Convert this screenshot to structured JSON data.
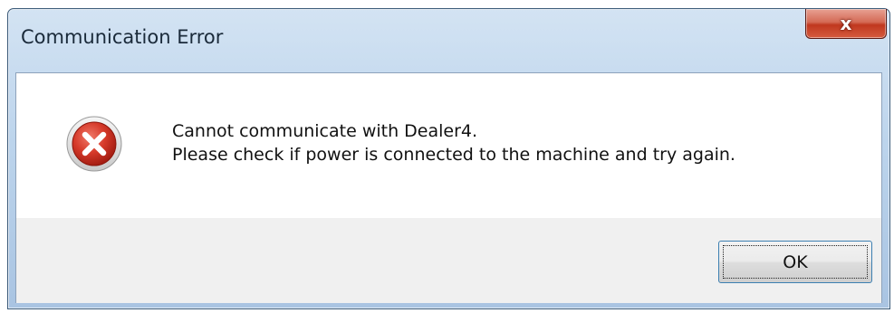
{
  "window": {
    "title": "Communication Error",
    "close_label": "x"
  },
  "message": {
    "line1": "Cannot communicate with Dealer4.",
    "line2": "Please check if power is connected to the machine and try again."
  },
  "buttons": {
    "ok_label": "OK"
  },
  "icons": {
    "status": "error-icon"
  },
  "colors": {
    "error_red": "#cc2a1c",
    "close_red": "#c0381f",
    "title_blue": "#bcd4ec"
  }
}
